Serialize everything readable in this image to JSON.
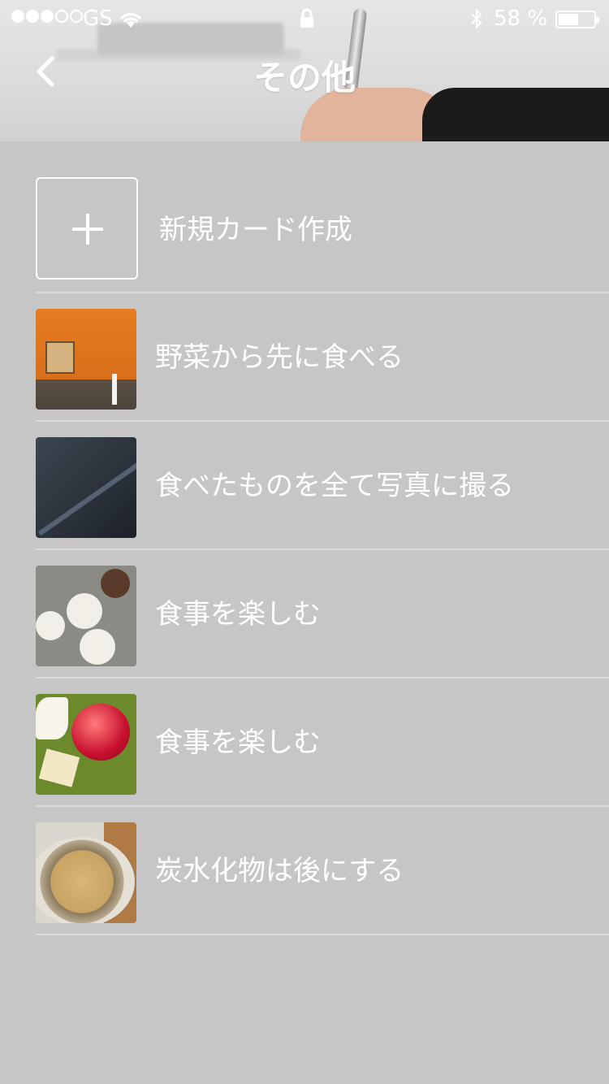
{
  "status_bar": {
    "carrier": "GS",
    "battery_percent": "58 %",
    "battery_level": 0.58,
    "signal_bars_filled": 3,
    "signal_bars_total": 5
  },
  "nav": {
    "title": "その他",
    "back_icon": "chevron-left-icon"
  },
  "new_card": {
    "label": "新規カード作成",
    "icon": "plus-icon"
  },
  "items": [
    {
      "label": "野菜から先に食べる",
      "thumb": "orange-wall-photo"
    },
    {
      "label": "食べたものを全て写真に撮る",
      "thumb": "staircase-photo"
    },
    {
      "label": "食事を楽しむ",
      "thumb": "table-meal-photo"
    },
    {
      "label": "食事を楽しむ",
      "thumb": "apple-cheese-photo"
    },
    {
      "label": "炭水化物は後にする",
      "thumb": "pasta-plate-photo"
    }
  ]
}
